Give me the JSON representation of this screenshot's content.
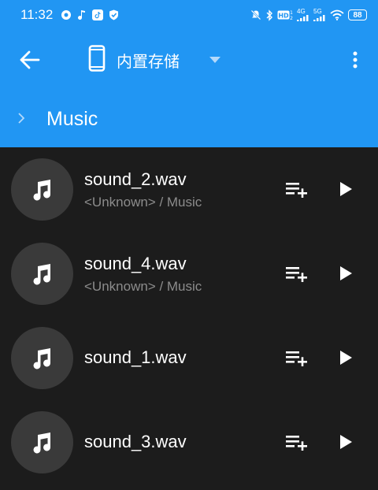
{
  "status_bar": {
    "time": "11:32",
    "left_icons": [
      "app-notification-icon",
      "music-note-icon",
      "tiktok-icon",
      "shield-icon"
    ],
    "right_icons": [
      "mute-icon",
      "bluetooth-icon",
      "hd-icon",
      "signal-4g-icon",
      "signal-5g-icon",
      "wifi-icon"
    ],
    "net1": "4G",
    "net2": "5G",
    "battery": "88"
  },
  "toolbar": {
    "storage_label": "内置存储",
    "icons": {
      "back": "arrow-left-icon",
      "device": "phone-icon",
      "dropdown": "triangle-down-icon",
      "more": "more-vert-icon"
    }
  },
  "breadcrumb": {
    "current": "Music"
  },
  "files": [
    {
      "name": "sound_2.wav",
      "subtitle": "<Unknown> / Music"
    },
    {
      "name": "sound_4.wav",
      "subtitle": "<Unknown> / Music"
    },
    {
      "name": "sound_1.wav",
      "subtitle": ""
    },
    {
      "name": "sound_3.wav",
      "subtitle": ""
    }
  ],
  "colors": {
    "primary": "#2196f3",
    "background": "#1c1c1c",
    "thumb_bg": "#3a3a3a",
    "subtitle": "#8c8c8c"
  }
}
